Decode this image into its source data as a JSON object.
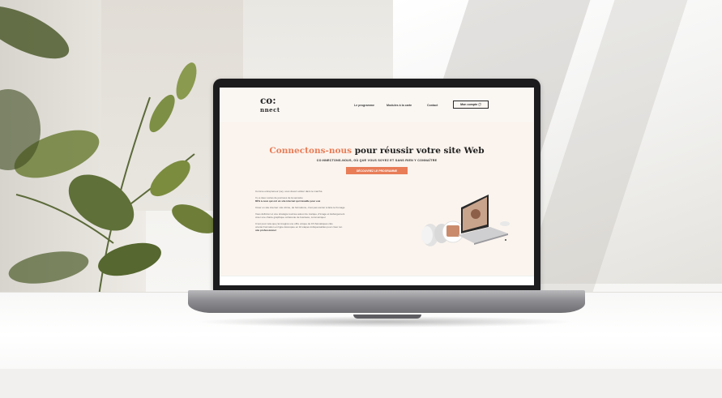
{
  "site": {
    "logo_line1": "co:",
    "logo_line2": "nnect",
    "nav": [
      "Le programme",
      "Modules à la carte",
      "Contact"
    ],
    "account_button": "Mon compte ⓘ",
    "hero": {
      "title_accent": "Connectons-nous",
      "title_rest": " pour réussir votre site Web",
      "subtitle": "CO:NNECTONS-NOUS, OÙ QUE VOUS SOYEZ ET SANS RIEN Y CONNAÎTRE",
      "cta": "DÉCOUVREZ LE PROGRAMME"
    },
    "paragraphs": [
      "Comme entrepreneur (se), vous devez exister dans le marché.",
      "Il y a deux sortes de journées de la semaine",
      "80% à ceux qui ont un site internet qui travaille pour eux",
      "Créer un site internet: site vitrine, de formations, c'est pas sorcier à faire le fromage",
      "Vous définirez et une stratégie tournée autour de marque, d'image et Hébergement",
      "créer une charte graphique cohérente de business, communiquer",
      "C'est pour cela que j'ai imaginé une offre unique de 15 thématiques clés",
      "orienté Formation en ligne découpée en 10 étapes indispensables pour créer ton",
      "site professionnel"
    ]
  },
  "colors": {
    "accent": "#e87d58",
    "screen_bg": "#fbf4ee",
    "bezel": "#1c1c1e"
  }
}
